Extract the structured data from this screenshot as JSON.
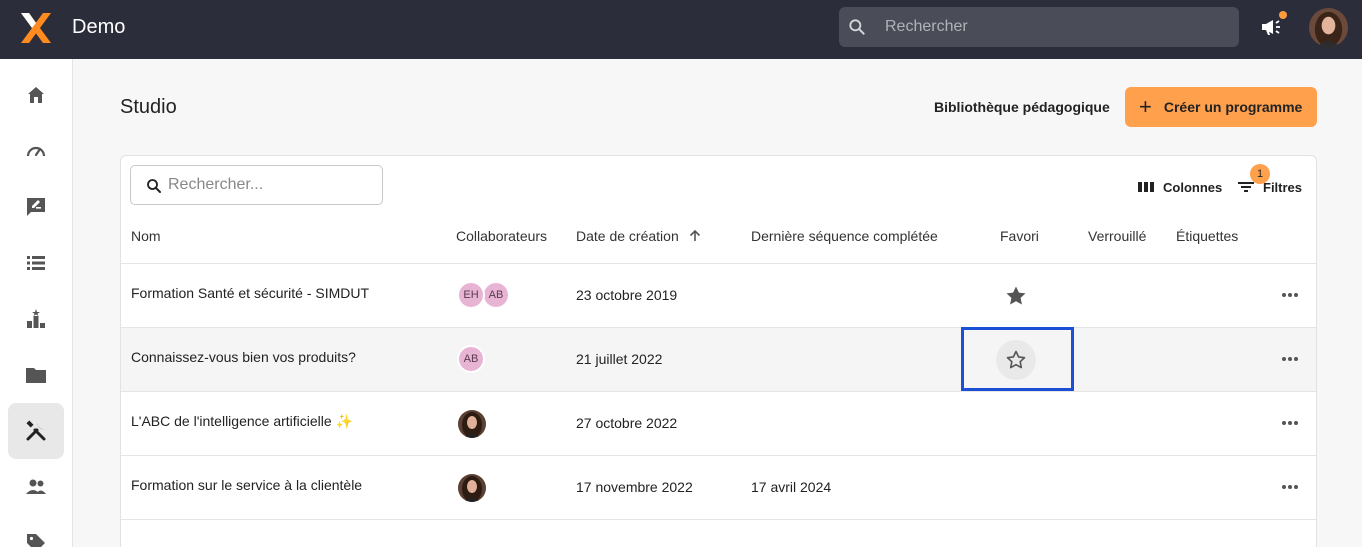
{
  "app": {
    "name": "Demo",
    "search_placeholder": "Rechercher"
  },
  "sidebar": {
    "items": [
      {
        "icon": "home-icon"
      },
      {
        "icon": "dashboard-icon"
      },
      {
        "icon": "feedback-icon"
      },
      {
        "icon": "list-icon"
      },
      {
        "icon": "leaderboard-icon"
      },
      {
        "icon": "folder-icon"
      },
      {
        "icon": "tools-icon",
        "active": true
      },
      {
        "icon": "people-icon"
      },
      {
        "icon": "tag-icon"
      }
    ]
  },
  "page": {
    "title": "Studio",
    "library_link": "Bibliothèque pédagogique",
    "create_button": "Créer un programme"
  },
  "table": {
    "search_placeholder": "Rechercher...",
    "columns_button": "Colonnes",
    "filters_button": "Filtres",
    "filters_count": "1",
    "headers": {
      "name": "Nom",
      "collaborators": "Collaborateurs",
      "created": "Date de création",
      "last_sequence": "Dernière séquence complétée",
      "favorite": "Favori",
      "locked": "Verrouillé",
      "tags": "Étiquettes"
    },
    "rows": [
      {
        "name": "Formation Santé et sécurité - SIMDUT",
        "collaborators": [
          "EH",
          "AB"
        ],
        "created": "23 octobre 2019",
        "last_sequence": "",
        "favorite": true
      },
      {
        "name": "Connaissez-vous bien vos produits?",
        "collaborators": [
          "AB"
        ],
        "created": "21 juillet 2022",
        "last_sequence": "",
        "favorite": false
      },
      {
        "name": "L'ABC de l'intelligence artificielle ✨",
        "collaborators": [
          "photo"
        ],
        "created": "27 octobre 2022",
        "last_sequence": "",
        "favorite": null
      },
      {
        "name": "Formation sur le service à la clientèle",
        "collaborators": [
          "photo"
        ],
        "created": "17 novembre 2022",
        "last_sequence": "17 avril 2024",
        "favorite": null
      }
    ]
  },
  "colors": {
    "topbar": "#2b2d3a",
    "accent": "#ffa04d",
    "focus": "#1a4fd6",
    "chip": "#e8b4d4"
  }
}
